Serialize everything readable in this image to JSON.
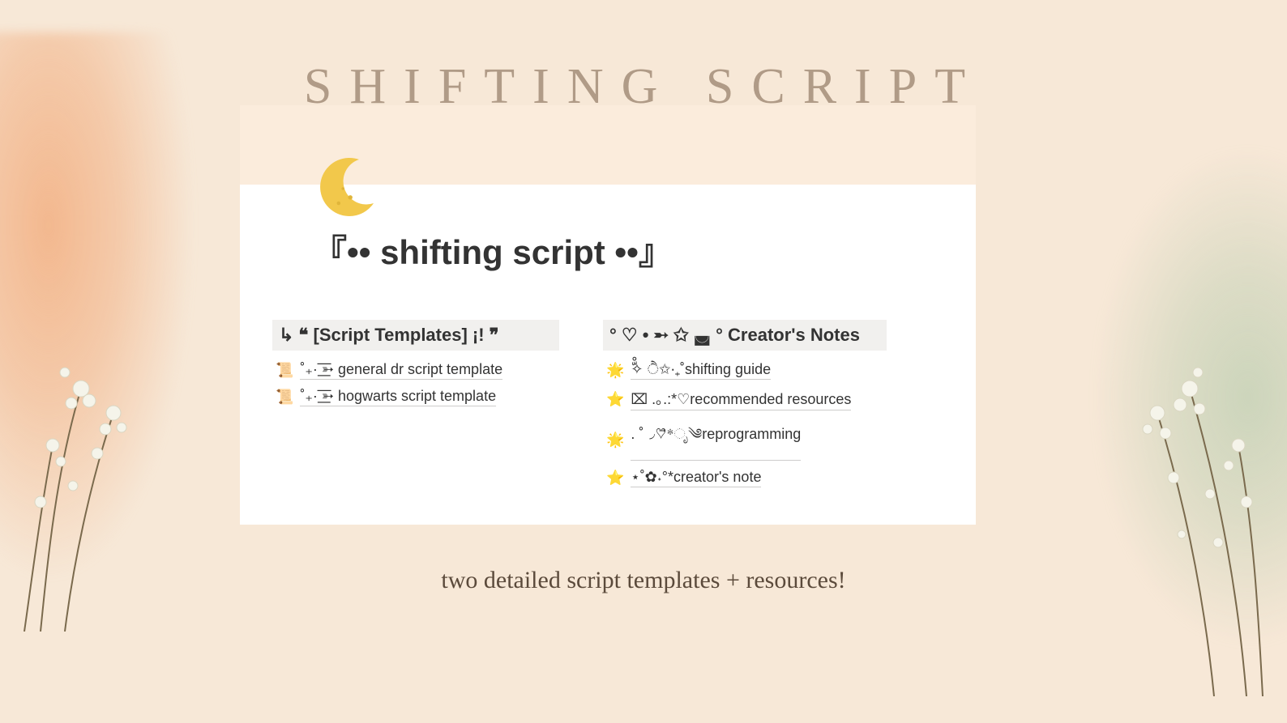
{
  "header": {
    "title": "SHIFTING SCRIPT"
  },
  "card": {
    "doc_title": "『•• shifting script ••』",
    "left": {
      "heading": "↳ ❝ [Script Templates] ¡! ❞",
      "items": [
        {
          "icon": "📜",
          "label": "˚₊· ͟͟͞͞➳ general dr script template"
        },
        {
          "icon": "📜",
          "label": "˚₊· ͟͟͞͞➳ hogwarts script template"
        }
      ]
    },
    "right": {
      "heading": "° ♡ • ➵ ✩ ◛ ° Creator's Notes",
      "items": [
        {
          "icon": "🌟",
          "label": "ْ✧ّ ੈ✩‧₊˚shifting guide"
        },
        {
          "icon": "⭐",
          "label": "⌧ .｡.:*♡recommended resources"
        },
        {
          "icon": "🌟",
          "label": ". ˚◞♡⃗*ೃ༄reprogramming"
        },
        {
          "icon": "⭐",
          "label": "⋆˚✿˖°*creator's note"
        }
      ]
    }
  },
  "subtitle": "two detailed script templates + resources!"
}
